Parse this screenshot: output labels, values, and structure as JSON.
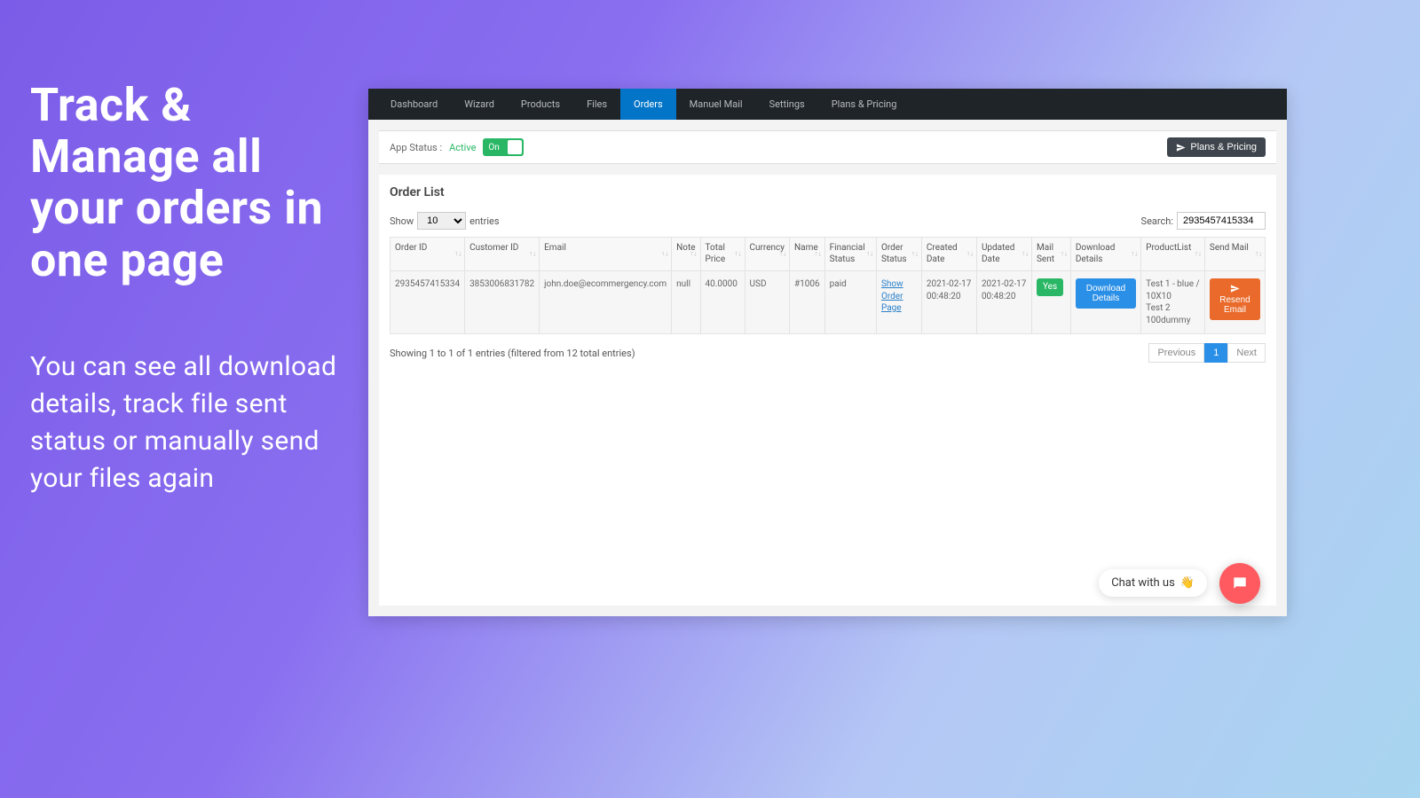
{
  "promo": {
    "title": "Track & Manage all your orders in one page",
    "subtitle": "You can see all download details, track file sent status or manually send your files again"
  },
  "nav": {
    "items": [
      "Dashboard",
      "Wizard",
      "Products",
      "Files",
      "Orders",
      "Manuel Mail",
      "Settings",
      "Plans & Pricing"
    ],
    "active_index": 4
  },
  "statusbar": {
    "label": "App Status :",
    "value": "Active",
    "toggle": "On",
    "plans_btn": "Plans & Pricing"
  },
  "card": {
    "title": "Order List",
    "show_prefix": "Show",
    "show_suffix": "entries",
    "entries_value": "10",
    "search_label": "Search:",
    "search_value": "2935457415334"
  },
  "table": {
    "headers": [
      "Order ID",
      "Customer ID",
      "Email",
      "Note",
      "Total Price",
      "Currency",
      "Name",
      "Financial Status",
      "Order Status",
      "Created Date",
      "Updated Date",
      "Mail Sent",
      "Download Details",
      "ProductList",
      "Send Mail"
    ],
    "row": {
      "order_id": "2935457415334",
      "customer_id": "3853006831782",
      "email": "john.doe@ecommergency.com",
      "note": "null",
      "total_price": "40.0000",
      "currency": "USD",
      "name": "#1006",
      "financial_status": "paid",
      "order_status": "Show Order Page",
      "created_date": "2021-02-17 00:48:20",
      "updated_date": "2021-02-17 00:48:20",
      "mail_sent": "Yes",
      "download_details": "Download Details",
      "product_list": "Test 1 - blue / 10X10\nTest 2\n100dummy",
      "resend": "Resend Email"
    }
  },
  "footer": {
    "info": "Showing 1 to 1 of 1 entries (filtered from 12 total entries)",
    "prev": "Previous",
    "page": "1",
    "next": "Next"
  },
  "chat": {
    "label": "Chat with us",
    "emoji": "👋"
  }
}
